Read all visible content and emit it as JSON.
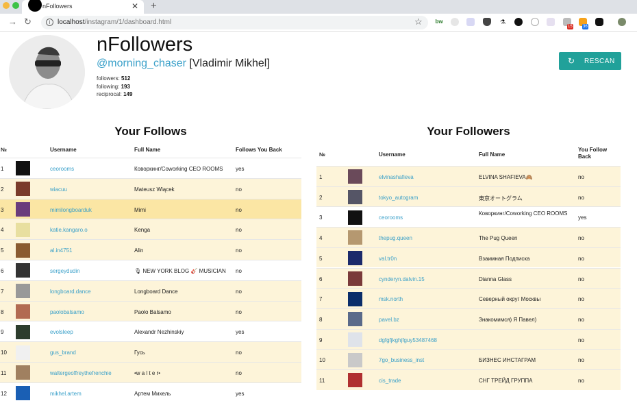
{
  "browser": {
    "tab_title": "nFollowers",
    "tab_close": "✕",
    "new_tab": "+",
    "url_host": "localhost",
    "url_path": "/instagram/1/dashboard.html",
    "ext_badges": [
      "15",
      "36"
    ]
  },
  "profile": {
    "name": "nFollowers",
    "handle": "@morning_chaser",
    "full_name": "[Vladimir Mikhel]",
    "followers_label": "followers:",
    "followers": "512",
    "following_label": "following:",
    "following": "193",
    "reciprocal_label": "reciprocal:",
    "reciprocal": "149"
  },
  "rescan": {
    "icon": "refresh-icon",
    "label": "RESCAN"
  },
  "colors": {
    "accent": "#21a19a",
    "link": "#3aa0c9",
    "row_highlight": "#fdf4d9",
    "row_selected": "#fbe6a4"
  },
  "follows": {
    "title": "Your Follows",
    "headers": {
      "num": "№",
      "username": "Username",
      "fullname": "Full Name",
      "back": "Follows You Back"
    },
    "rows": [
      {
        "n": "1",
        "user": "ceorooms",
        "full": "Коворкинг/Coworking CEO ROOMS",
        "back": "yes",
        "state": "plain",
        "thumb": "#111"
      },
      {
        "n": "2",
        "user": "wiacuu",
        "full": "Mateusz Wiącek",
        "back": "no",
        "state": "hl",
        "thumb": "#7a3b2a"
      },
      {
        "n": "3",
        "user": "mimilongboarduk",
        "full": "Mimi",
        "back": "no",
        "state": "sel",
        "thumb": "#6a3c7c"
      },
      {
        "n": "4",
        "user": "katie.kangaro.o",
        "full": "Kenga",
        "back": "no",
        "state": "hl",
        "thumb": "#e8dfa0"
      },
      {
        "n": "5",
        "user": "al.in4751",
        "full": "Alin",
        "back": "no",
        "state": "hl",
        "thumb": "#8a5b30"
      },
      {
        "n": "6",
        "user": "sergeydudin",
        "full": "🎙 NEW YORK BLOG 🎸 MUSICIAN",
        "back": "no",
        "state": "plain",
        "thumb": "#333"
      },
      {
        "n": "7",
        "user": "longboard.dance",
        "full": "Longboard Dance",
        "back": "no",
        "state": "hl",
        "thumb": "#999"
      },
      {
        "n": "8",
        "user": "paolobalsamo",
        "full": "Paolo Balsamo",
        "back": "no",
        "state": "hl",
        "thumb": "#b26b52"
      },
      {
        "n": "9",
        "user": "evolsleep",
        "full": "Alexandr Nezhinskiy",
        "back": "yes",
        "state": "plain",
        "thumb": "#2d3d2d"
      },
      {
        "n": "10",
        "user": "gus_brand",
        "full": "Гусь",
        "back": "no",
        "state": "hl",
        "thumb": "#f0f0f0"
      },
      {
        "n": "11",
        "user": "waltergeoffreythefrenchie",
        "full": "•w a l t e r•",
        "back": "no",
        "state": "hl",
        "thumb": "#a08060"
      },
      {
        "n": "12",
        "user": "mikhel.artem",
        "full": "Артем Михель",
        "back": "yes",
        "state": "plain",
        "thumb": "#1a5fb4"
      }
    ]
  },
  "followers": {
    "title": "Your Followers",
    "headers": {
      "num": "№",
      "username": "Username",
      "fullname": "Full Name",
      "back1": "You Follow",
      "back2": "Back"
    },
    "rows": [
      {
        "n": "1",
        "user": "elvinashafieva",
        "full": "ELVINA SHAFIEVA🙈",
        "back": "no",
        "state": "hl",
        "thumb": "#6a4a5a"
      },
      {
        "n": "2",
        "user": "tokyo_autogram",
        "full": "東京オートグラム",
        "back": "no",
        "state": "hl",
        "thumb": "#556"
      },
      {
        "n": "3",
        "user": "ceorooms",
        "full": "Коворкинг/Coworking CEO ROOMS",
        "back": "yes",
        "state": "plain",
        "thumb": "#111"
      },
      {
        "n": "4",
        "user": "thepug.queen",
        "full": "The Pug Queen",
        "back": "no",
        "state": "hl",
        "thumb": "#b59870"
      },
      {
        "n": "5",
        "user": "val.tr0n",
        "full": "Взаимная Подписка",
        "back": "no",
        "state": "hl",
        "thumb": "#1b2a6b"
      },
      {
        "n": "6",
        "user": "cynderyn.dalvin.15",
        "full": "Dianna Glass",
        "back": "no",
        "state": "hl",
        "thumb": "#7a3a3a"
      },
      {
        "n": "7",
        "user": "msk.north",
        "full": "Северный округ Москвы",
        "back": "no",
        "state": "hl",
        "thumb": "#0a2d6a"
      },
      {
        "n": "8",
        "user": "pavel.bz",
        "full": "Знакомимся) Я Павел)",
        "back": "no",
        "state": "hl",
        "thumb": "#5a6a8a"
      },
      {
        "n": "9",
        "user": "dgfgfjkghjfguy53487468",
        "full": "",
        "back": "no",
        "state": "hl",
        "thumb": "#dfe3ea"
      },
      {
        "n": "10",
        "user": "7go_business_inst",
        "full": "БИЗНЕС ИНСТАГРАМ",
        "back": "no",
        "state": "hl",
        "thumb": "#c9c9c9"
      },
      {
        "n": "11",
        "user": "cis_trade",
        "full": "СНГ ТРЕЙД ГРУППА",
        "back": "no",
        "state": "hl",
        "thumb": "#b03030"
      }
    ]
  }
}
